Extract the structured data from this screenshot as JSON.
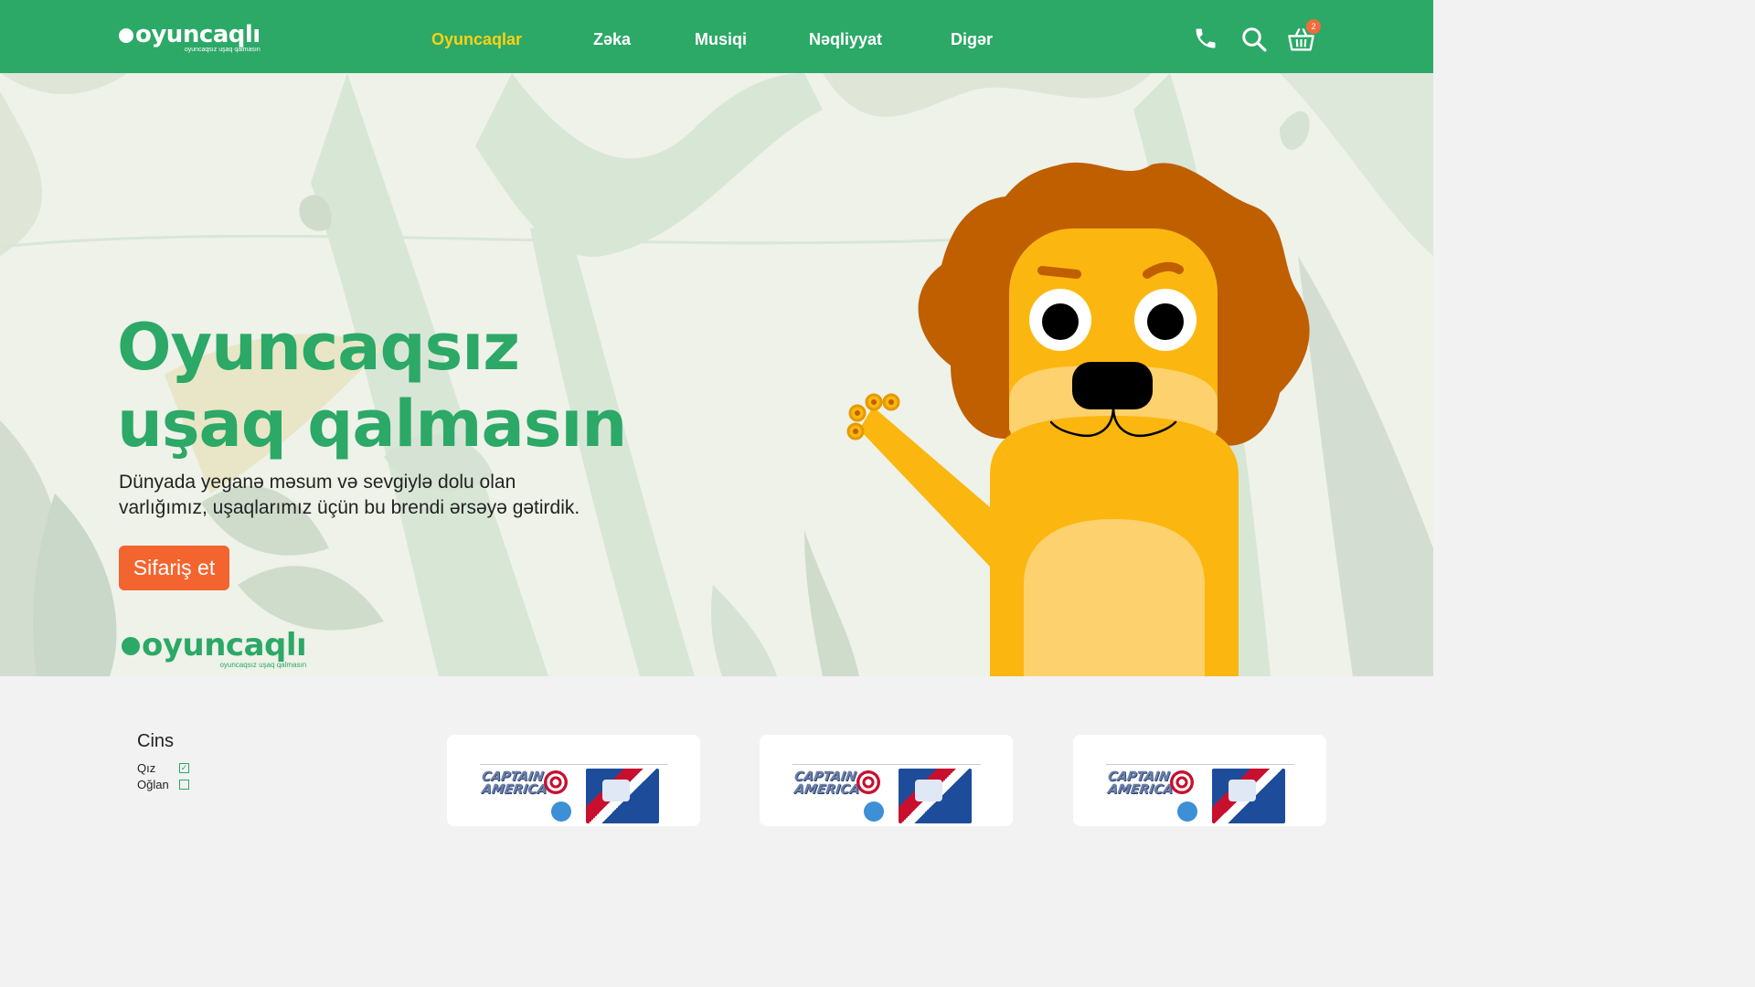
{
  "header": {
    "logo_text": "oyuncaqlı",
    "logo_tagline": "oyuncaqsız uşaq qalmasın",
    "nav": [
      {
        "label": "Oyuncaqlar",
        "active": true
      },
      {
        "label": "Zəka",
        "active": false
      },
      {
        "label": "Musiqi",
        "active": false
      },
      {
        "label": "Nəqliyyat",
        "active": false
      },
      {
        "label": "Digər",
        "active": false
      }
    ],
    "icons": [
      "phone-icon",
      "search-icon",
      "basket-icon"
    ],
    "cart_count": "2"
  },
  "hero": {
    "title_line1": "Oyuncaqsız",
    "title_line2": "uşaq qalmasın",
    "subtitle_line1": "Dünyada yeganə məsum və sevgiylə dolu olan",
    "subtitle_line2": "varlığımız, uşaqlarımız üçün bu brendi ərsəyə gətirdik.",
    "cta_label": "Sifariş et",
    "logo_text": "oyuncaqlı",
    "logo_tagline": "oyuncaqsız uşaq qalmasın"
  },
  "filters": {
    "title": "Cins",
    "options": [
      {
        "label": "Qız",
        "checked": true
      },
      {
        "label": "Oğlan",
        "checked": false
      }
    ]
  },
  "products": [
    {
      "image_text_line1": "CAPTAIN",
      "image_text_line2": "AMERICA"
    },
    {
      "image_text_line1": "CAPTAIN",
      "image_text_line2": "AMERICA"
    },
    {
      "image_text_line1": "CAPTAIN",
      "image_text_line2": "AMERICA"
    }
  ],
  "colors": {
    "brand_green": "#2ca867",
    "nav_active": "#fcd117",
    "cta_orange": "#f4642e",
    "lion_yellow": "#fbb710",
    "lion_mane": "#bf5f00"
  }
}
